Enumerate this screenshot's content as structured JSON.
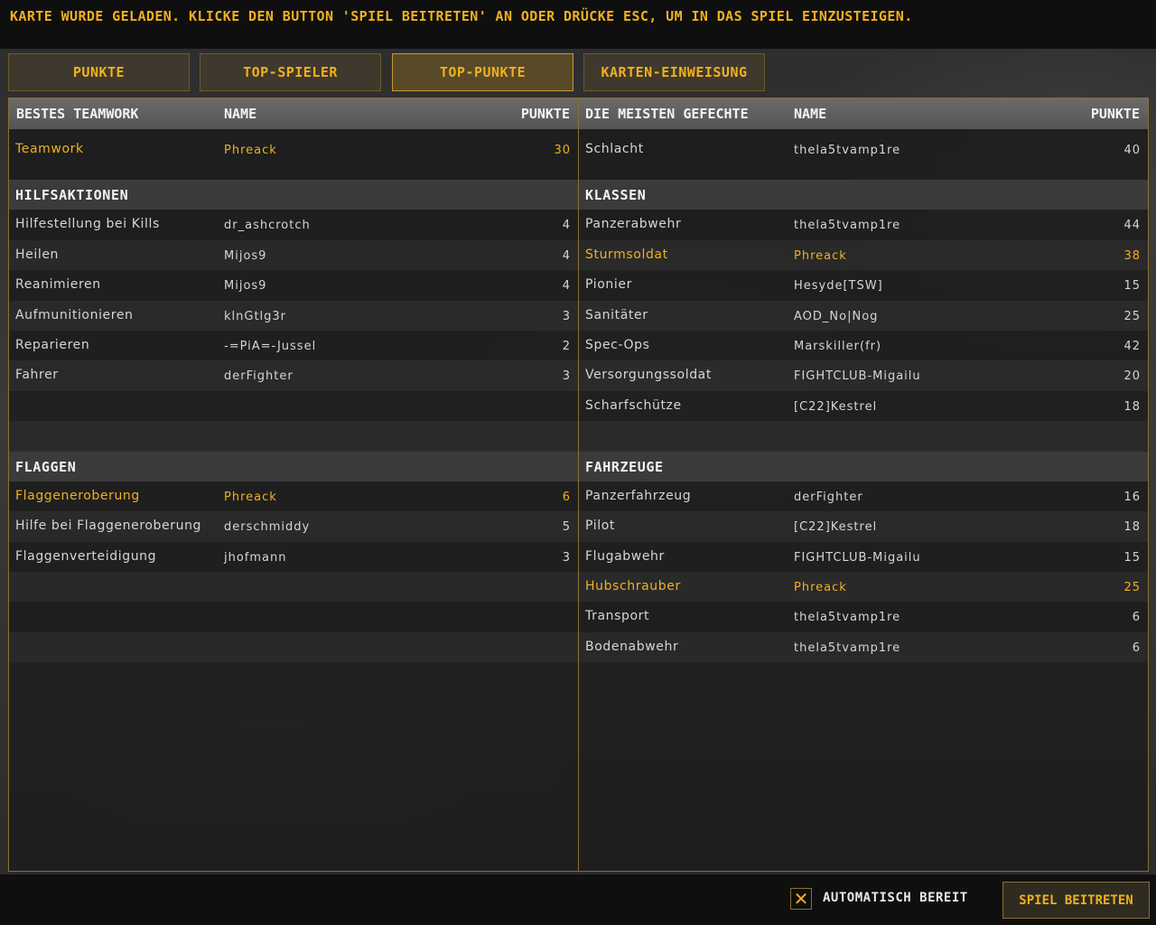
{
  "header": {
    "message": "KARTE WURDE GELADEN. KLICKE DEN BUTTON 'SPIEL BEITRETEN' AN ODER DRÜCKE ESC, UM IN DAS SPIEL EINZUSTEIGEN."
  },
  "tabs": [
    {
      "label": "PUNKTE",
      "active": false
    },
    {
      "label": "TOP-SPIELER",
      "active": false
    },
    {
      "label": "TOP-PUNKTE",
      "active": true
    },
    {
      "label": "KARTEN-EINWEISUNG",
      "active": false
    }
  ],
  "left": {
    "headers": {
      "category": "BESTES TEAMWORK",
      "name": "NAME",
      "points": "PUNKTE"
    },
    "top_row": {
      "category": "Teamwork",
      "name": "Phreack",
      "points": "30"
    },
    "sections": [
      {
        "title": "HILFSAKTIONEN",
        "rows": [
          {
            "category": "Hilfestellung bei Kills",
            "name": "dr_ashcrotch",
            "points": "4"
          },
          {
            "category": "Heilen",
            "name": "Mijos9",
            "points": "4"
          },
          {
            "category": "Reanimieren",
            "name": "Mijos9",
            "points": "4"
          },
          {
            "category": "Aufmunitionieren",
            "name": "klnGtlg3r",
            "points": "3"
          },
          {
            "category": "Reparieren",
            "name": "-=PiA=-Jussel",
            "points": "2"
          },
          {
            "category": "Fahrer",
            "name": "derFighter",
            "points": "3"
          }
        ]
      },
      {
        "title": "FLAGGEN",
        "rows": [
          {
            "category": "Flaggeneroberung",
            "name": "Phreack",
            "points": "6"
          },
          {
            "category": "Hilfe bei Flaggeneroberung",
            "name": "derschmiddy",
            "points": "5"
          },
          {
            "category": "Flaggenverteidigung",
            "name": "jhofmann",
            "points": "3"
          }
        ]
      }
    ]
  },
  "right": {
    "headers": {
      "category": "DIE MEISTEN GEFECHTE",
      "name": "NAME",
      "points": "PUNKTE"
    },
    "top_row": {
      "category": "Schlacht",
      "name": "thela5tvamp1re",
      "points": "40"
    },
    "sections": [
      {
        "title": "KLASSEN",
        "rows": [
          {
            "category": "Panzerabwehr",
            "name": "thela5tvamp1re",
            "points": "44"
          },
          {
            "category": "Sturmsoldat",
            "name": "Phreack",
            "points": "38"
          },
          {
            "category": "Pionier",
            "name": "Hesyde[TSW]",
            "points": "15"
          },
          {
            "category": "Sanitäter",
            "name": "AOD_No|Nog",
            "points": "25"
          },
          {
            "category": "Spec-Ops",
            "name": "Marskiller(fr)",
            "points": "42"
          },
          {
            "category": "Versorgungssoldat",
            "name": "FIGHTCLUB-Migailu",
            "points": "20"
          },
          {
            "category": "Scharfschütze",
            "name": "[C22]Kestrel",
            "points": "18"
          }
        ]
      },
      {
        "title": "FAHRZEUGE",
        "rows": [
          {
            "category": "Panzerfahrzeug",
            "name": "derFighter",
            "points": "16"
          },
          {
            "category": "Pilot",
            "name": "[C22]Kestrel",
            "points": "18"
          },
          {
            "category": "Flugabwehr",
            "name": "FIGHTCLUB-Migailu",
            "points": "15"
          },
          {
            "category": "Hubschrauber",
            "name": "Phreack",
            "points": "25"
          },
          {
            "category": "Transport",
            "name": "thela5tvamp1re",
            "points": "6"
          },
          {
            "category": "Bodenabwehr",
            "name": "thela5tvamp1re",
            "points": "6"
          }
        ]
      }
    ]
  },
  "highlight_player": "Phreack",
  "footer": {
    "auto_ready_label": "AUTOMATISCH BEREIT",
    "auto_ready_checked": true,
    "join_label": "SPIEL BEITRETEN"
  },
  "colors": {
    "accent": "#f0b020",
    "border": "#8a7030"
  }
}
